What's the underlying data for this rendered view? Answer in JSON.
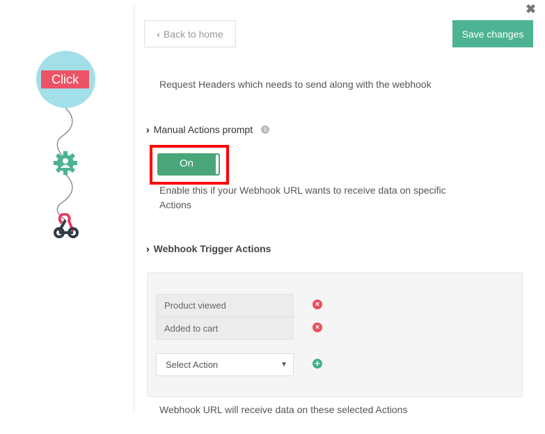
{
  "sidebar": {
    "trigger_label": "Click",
    "icons": [
      "gear-user-icon",
      "webhook-icon"
    ]
  },
  "header": {
    "back_label": "Back to home",
    "save_label": "Save changes",
    "close_icon": "close-icon"
  },
  "headers_help": "Request Headers which needs to send along with the webhook",
  "manual_actions": {
    "title": "Manual Actions prompt",
    "toggle_label": "On",
    "toggle_on": true,
    "help": "Enable this if your Webhook URL wants to receive data on specific Actions"
  },
  "trigger_actions": {
    "title": "Webhook Trigger Actions",
    "items": [
      {
        "label": "Product viewed"
      },
      {
        "label": "Added to cart"
      }
    ],
    "select_value": "Select Action",
    "help": "Webhook URL will receive data on these selected Actions"
  },
  "colors": {
    "accent": "#4db393",
    "toggle": "#4aa57a",
    "remove": "#e8505f",
    "click": "#ec5367",
    "bubble": "#a3dfe8",
    "highlight": "#ff0000"
  }
}
